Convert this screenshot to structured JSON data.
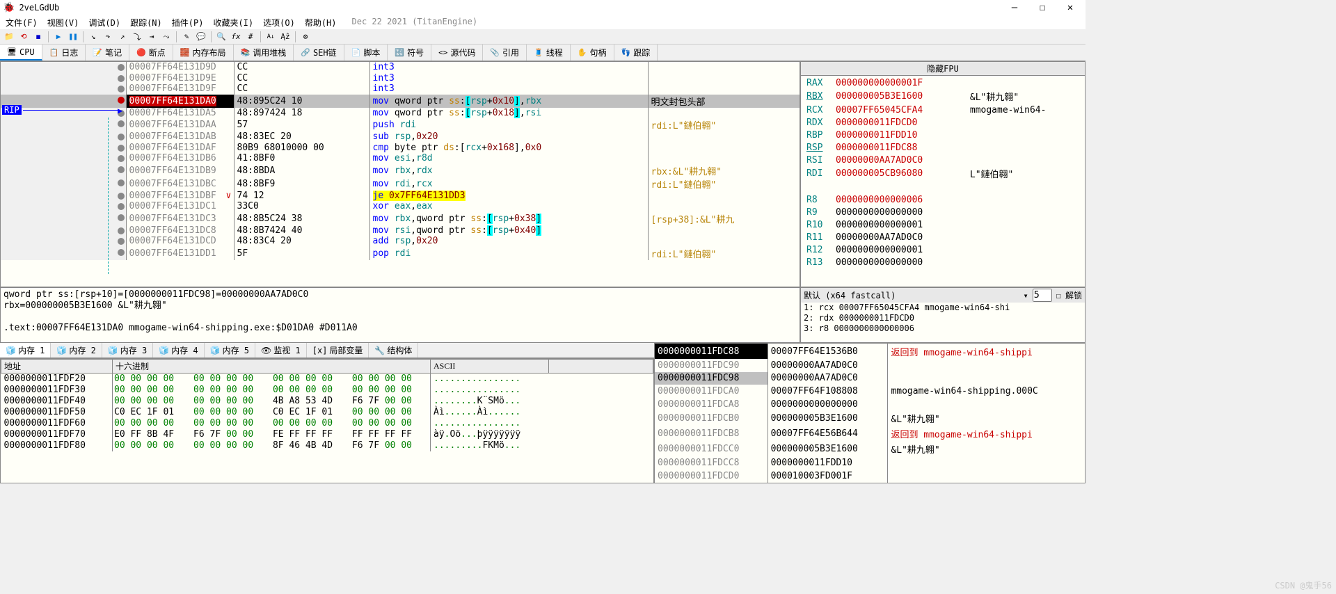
{
  "window": {
    "title": "2veLGdUb",
    "min": "—",
    "max": "☐",
    "close": "✕"
  },
  "menus": [
    "文件(F)",
    "视图(V)",
    "调试(D)",
    "跟踪(N)",
    "插件(P)",
    "收藏夹(I)",
    "选项(O)",
    "帮助(H)"
  ],
  "menu_date": "Dec 22 2021 (TitanEngine)",
  "tabs": [
    "CPU",
    "日志",
    "笔记",
    "断点",
    "内存布局",
    "调用堆栈",
    "SEH链",
    "脚本",
    "符号",
    "源代码",
    "引用",
    "线程",
    "句柄",
    "跟踪"
  ],
  "tab_icons": [
    "🖥",
    "📋",
    "📝",
    "🔴",
    "🧱",
    "📚",
    "🔗",
    "📄",
    "🔣",
    "<>",
    "📎",
    "🧵",
    "✋",
    "👣"
  ],
  "rip_label": "RIP",
  "disasm": [
    {
      "addr": "00007FF64E131D9D",
      "bytes": "CC",
      "dis": [
        {
          "t": "int3",
          "c": "mnemonic"
        }
      ],
      "cmt": ""
    },
    {
      "addr": "00007FF64E131D9E",
      "bytes": "CC",
      "dis": [
        {
          "t": "int3",
          "c": "mnemonic"
        }
      ],
      "cmt": ""
    },
    {
      "addr": "00007FF64E131D9F",
      "bytes": "CC",
      "dis": [
        {
          "t": "int3",
          "c": "mnemonic"
        }
      ],
      "cmt": ""
    },
    {
      "addr": "00007FF64E131DA0",
      "bytes": "48:895C24 10",
      "cur": true,
      "dis": [
        {
          "t": "mov ",
          "c": "mnemonic"
        },
        {
          "t": "qword ptr ",
          "c": ""
        },
        {
          "t": "ss",
          "c": "seg"
        },
        {
          "t": ":",
          "c": ""
        },
        {
          "t": "[",
          "c": "bracket-hi"
        },
        {
          "t": "rsp",
          "c": "reg"
        },
        {
          "t": "+",
          "c": ""
        },
        {
          "t": "0x10",
          "c": "imm"
        },
        {
          "t": "]",
          "c": "bracket-hi"
        },
        {
          "t": ",",
          "c": ""
        },
        {
          "t": "rbx",
          "c": "reg"
        }
      ],
      "cmt": "明文封包头部"
    },
    {
      "addr": "00007FF64E131DA5",
      "bytes": "48:897424 18",
      "dis": [
        {
          "t": "mov ",
          "c": "mnemonic"
        },
        {
          "t": "qword ptr ",
          "c": ""
        },
        {
          "t": "ss",
          "c": "seg"
        },
        {
          "t": ":",
          "c": ""
        },
        {
          "t": "[",
          "c": "bracket-hi"
        },
        {
          "t": "rsp",
          "c": "reg"
        },
        {
          "t": "+",
          "c": ""
        },
        {
          "t": "0x18",
          "c": "imm"
        },
        {
          "t": "]",
          "c": "bracket-hi"
        },
        {
          "t": ",",
          "c": ""
        },
        {
          "t": "rsi",
          "c": "reg"
        }
      ],
      "cmt": ""
    },
    {
      "addr": "00007FF64E131DAA",
      "bytes": "57",
      "dis": [
        {
          "t": "push ",
          "c": "mnemonic"
        },
        {
          "t": "rdi",
          "c": "reg"
        }
      ],
      "cmt": "rdi:L\"鏈伯翱\""
    },
    {
      "addr": "00007FF64E131DAB",
      "bytes": "48:83EC 20",
      "dis": [
        {
          "t": "sub ",
          "c": "mnemonic"
        },
        {
          "t": "rsp",
          "c": "reg"
        },
        {
          "t": ",",
          "c": ""
        },
        {
          "t": "0x20",
          "c": "imm"
        }
      ],
      "cmt": ""
    },
    {
      "addr": "00007FF64E131DAF",
      "bytes": "80B9 68010000 00",
      "dis": [
        {
          "t": "cmp ",
          "c": "mnemonic"
        },
        {
          "t": "byte ptr ",
          "c": ""
        },
        {
          "t": "ds",
          "c": "seg"
        },
        {
          "t": ":[",
          "c": ""
        },
        {
          "t": "rcx",
          "c": "reg"
        },
        {
          "t": "+",
          "c": ""
        },
        {
          "t": "0x168",
          "c": "imm"
        },
        {
          "t": "],",
          "c": ""
        },
        {
          "t": "0x0",
          "c": "imm"
        }
      ],
      "cmt": ""
    },
    {
      "addr": "00007FF64E131DB6",
      "bytes": "41:8BF0",
      "dis": [
        {
          "t": "mov ",
          "c": "mnemonic"
        },
        {
          "t": "esi",
          "c": "reg"
        },
        {
          "t": ",",
          "c": ""
        },
        {
          "t": "r8d",
          "c": "reg"
        }
      ],
      "cmt": ""
    },
    {
      "addr": "00007FF64E131DB9",
      "bytes": "48:8BDA",
      "dis": [
        {
          "t": "mov ",
          "c": "mnemonic"
        },
        {
          "t": "rbx",
          "c": "reg"
        },
        {
          "t": ",",
          "c": ""
        },
        {
          "t": "rdx",
          "c": "reg"
        }
      ],
      "cmt": "rbx:&L\"耕九翱\""
    },
    {
      "addr": "00007FF64E131DBC",
      "bytes": "48:8BF9",
      "dis": [
        {
          "t": "mov ",
          "c": "mnemonic"
        },
        {
          "t": "rdi",
          "c": "reg"
        },
        {
          "t": ",",
          "c": ""
        },
        {
          "t": "rcx",
          "c": "reg"
        }
      ],
      "cmt": "rdi:L\"鏈伯翱\""
    },
    {
      "addr": "00007FF64E131DBF",
      "bytes": "74 12",
      "je": true,
      "dis": [
        {
          "t": "je ",
          "c": "mnemonic je-hi"
        },
        {
          "t": "0x7FF64E131DD3",
          "c": "imm je-hi"
        }
      ],
      "cmt": ""
    },
    {
      "addr": "00007FF64E131DC1",
      "bytes": "33C0",
      "dis": [
        {
          "t": "xor ",
          "c": "mnemonic"
        },
        {
          "t": "eax",
          "c": "reg"
        },
        {
          "t": ",",
          "c": ""
        },
        {
          "t": "eax",
          "c": "reg"
        }
      ],
      "cmt": ""
    },
    {
      "addr": "00007FF64E131DC3",
      "bytes": "48:8B5C24 38",
      "dis": [
        {
          "t": "mov ",
          "c": "mnemonic"
        },
        {
          "t": "rbx",
          "c": "reg"
        },
        {
          "t": ",",
          "c": ""
        },
        {
          "t": "qword ptr ",
          "c": ""
        },
        {
          "t": "ss",
          "c": "seg"
        },
        {
          "t": ":",
          "c": ""
        },
        {
          "t": "[",
          "c": "bracket-hi"
        },
        {
          "t": "rsp",
          "c": "reg"
        },
        {
          "t": "+",
          "c": ""
        },
        {
          "t": "0x38",
          "c": "imm"
        },
        {
          "t": "]",
          "c": "bracket-hi"
        }
      ],
      "cmt": "[rsp+38]:&L\"耕九"
    },
    {
      "addr": "00007FF64E131DC8",
      "bytes": "48:8B7424 40",
      "dis": [
        {
          "t": "mov ",
          "c": "mnemonic"
        },
        {
          "t": "rsi",
          "c": "reg"
        },
        {
          "t": ",",
          "c": ""
        },
        {
          "t": "qword ptr ",
          "c": ""
        },
        {
          "t": "ss",
          "c": "seg"
        },
        {
          "t": ":",
          "c": ""
        },
        {
          "t": "[",
          "c": "bracket-hi"
        },
        {
          "t": "rsp",
          "c": "reg"
        },
        {
          "t": "+",
          "c": ""
        },
        {
          "t": "0x40",
          "c": "imm"
        },
        {
          "t": "]",
          "c": "bracket-hi"
        }
      ],
      "cmt": ""
    },
    {
      "addr": "00007FF64E131DCD",
      "bytes": "48:83C4 20",
      "dis": [
        {
          "t": "add ",
          "c": "mnemonic"
        },
        {
          "t": "rsp",
          "c": "reg"
        },
        {
          "t": ",",
          "c": ""
        },
        {
          "t": "0x20",
          "c": "imm"
        }
      ],
      "cmt": ""
    },
    {
      "addr": "00007FF64E131DD1",
      "bytes": "5F",
      "dis": [
        {
          "t": "pop ",
          "c": "mnemonic"
        },
        {
          "t": "rdi",
          "c": "reg"
        }
      ],
      "cmt": "rdi:L\"鏈伯翱\""
    }
  ],
  "reg_header": "隐藏FPU",
  "regs": [
    {
      "n": "RAX",
      "v": "000000000000001F",
      "c": "",
      "red": true
    },
    {
      "n": "RBX",
      "v": "000000005B3E1600",
      "c": "&L\"耕九翱\"",
      "red": true,
      "u": true
    },
    {
      "n": "RCX",
      "v": "00007FF65045CFA4",
      "c": "mmogame-win64-",
      "red": true
    },
    {
      "n": "RDX",
      "v": "0000000011FDCD0",
      "c": "",
      "red": true
    },
    {
      "n": "RBP",
      "v": "0000000011FDD10",
      "c": "",
      "red": true
    },
    {
      "n": "RSP",
      "v": "0000000011FDC88",
      "c": "",
      "red": true,
      "u": true
    },
    {
      "n": "RSI",
      "v": "00000000AA7AD0C0",
      "c": "",
      "red": true
    },
    {
      "n": "RDI",
      "v": "000000005CB96080",
      "c": "L\"鏈伯翱\"",
      "red": true
    },
    {
      "n": "",
      "v": "",
      "c": ""
    },
    {
      "n": "R8",
      "v": "0000000000000006",
      "c": "",
      "red": true
    },
    {
      "n": "R9",
      "v": "0000000000000000",
      "c": ""
    },
    {
      "n": "R10",
      "v": "0000000000000001",
      "c": ""
    },
    {
      "n": "R11",
      "v": "00000000AA7AD0C0",
      "c": ""
    },
    {
      "n": "R12",
      "v": "0000000000000001",
      "c": ""
    },
    {
      "n": "R13",
      "v": "0000000000000000",
      "c": ""
    }
  ],
  "info": [
    "qword ptr ss:[rsp+10]=[0000000011FDC98]=00000000AA7AD0C0",
    "rbx=000000005B3E1600 &L\"耕九翱\"",
    "",
    ".text:00007FF64E131DA0 mmogame-win64-shipping.exe:$D01DA0 #D011A0"
  ],
  "args_header": "默认 (x64 fastcall)",
  "args_count": "5",
  "args_lock": "解锁",
  "args": [
    "1: rcx 00007FF65045CFA4 mmogame-win64-shi",
    "2: rdx 0000000011FDCD0",
    "3: r8 0000000000000006"
  ],
  "dump_tabs": [
    "内存 1",
    "内存 2",
    "内存 3",
    "内存 4",
    "内存 5",
    "监视 1",
    "局部变量",
    "结构体"
  ],
  "dump_headers": [
    "地址",
    "十六进制",
    "ASCII"
  ],
  "dump": [
    {
      "a": "0000000011FDF20",
      "h": [
        "00 00 00 00",
        "00 00 00 00",
        "00 00 00 00",
        "00 00 00 00"
      ],
      "nz": [],
      "asc": "................"
    },
    {
      "a": "0000000011FDF30",
      "h": [
        "00 00 00 00",
        "00 00 00 00",
        "00 00 00 00",
        "00 00 00 00"
      ],
      "nz": [],
      "asc": "................"
    },
    {
      "a": "0000000011FDF40",
      "h": [
        "00 00 00 00",
        "00 00 00 00",
        "4B A8 53 4D",
        "F6 7F 00 00"
      ],
      "nz": [
        2,
        3
      ],
      "asc": "........K¨SMö..."
    },
    {
      "a": "0000000011FDF50",
      "h": [
        "C0 EC 1F 01",
        "00 00 00 00",
        "C0 EC 1F 01",
        "00 00 00 00"
      ],
      "nz": [
        0,
        2
      ],
      "asc": "Àì......Àì......"
    },
    {
      "a": "0000000011FDF60",
      "h": [
        "00 00 00 00",
        "00 00 00 00",
        "00 00 00 00",
        "00 00 00 00"
      ],
      "nz": [],
      "asc": "................"
    },
    {
      "a": "0000000011FDF70",
      "h": [
        "E0 FF 8B 4F",
        "F6 7F 00 00",
        "FE FF FF FF",
        "FF FF FF FF"
      ],
      "nz": [
        0,
        1,
        2,
        3
      ],
      "asc": "àÿ.Oö...þÿÿÿÿÿÿÿ"
    },
    {
      "a": "0000000011FDF80",
      "h": [
        "00 00 00 00",
        "00 00 00 00",
        "8F 46 4B 4D",
        "F6 7F 00 00"
      ],
      "nz": [
        2,
        3
      ],
      "asc": ".........FKMö..."
    }
  ],
  "stack": [
    {
      "a": "0000000011FDC88",
      "v": "00007FF64E1536B0",
      "c": "返回到 mmogame-win64-shippi",
      "cur": true,
      "ret": true
    },
    {
      "a": "0000000011FDC90",
      "v": "00000000AA7AD0C0",
      "c": ""
    },
    {
      "a": "0000000011FDC98",
      "v": "00000000AA7AD0C0",
      "c": "",
      "sel": true
    },
    {
      "a": "0000000011FDCA0",
      "v": "00007FF64F108808",
      "c": "mmogame-win64-shipping.000C"
    },
    {
      "a": "0000000011FDCA8",
      "v": "0000000000000000",
      "c": ""
    },
    {
      "a": "0000000011FDCB0",
      "v": "000000005B3E1600",
      "c": "&L\"耕九翱\""
    },
    {
      "a": "0000000011FDCB8",
      "v": "00007FF64E56B644",
      "c": "返回到 mmogame-win64-shippi",
      "ret": true
    },
    {
      "a": "0000000011FDCC0",
      "v": "000000005B3E1600",
      "c": "&L\"耕九翱\""
    },
    {
      "a": "0000000011FDCC8",
      "v": "0000000011FDD10",
      "c": ""
    },
    {
      "a": "0000000011FDCD0",
      "v": "000010003FD001F",
      "c": ""
    }
  ],
  "watermark": "CSDN @鬼手56"
}
